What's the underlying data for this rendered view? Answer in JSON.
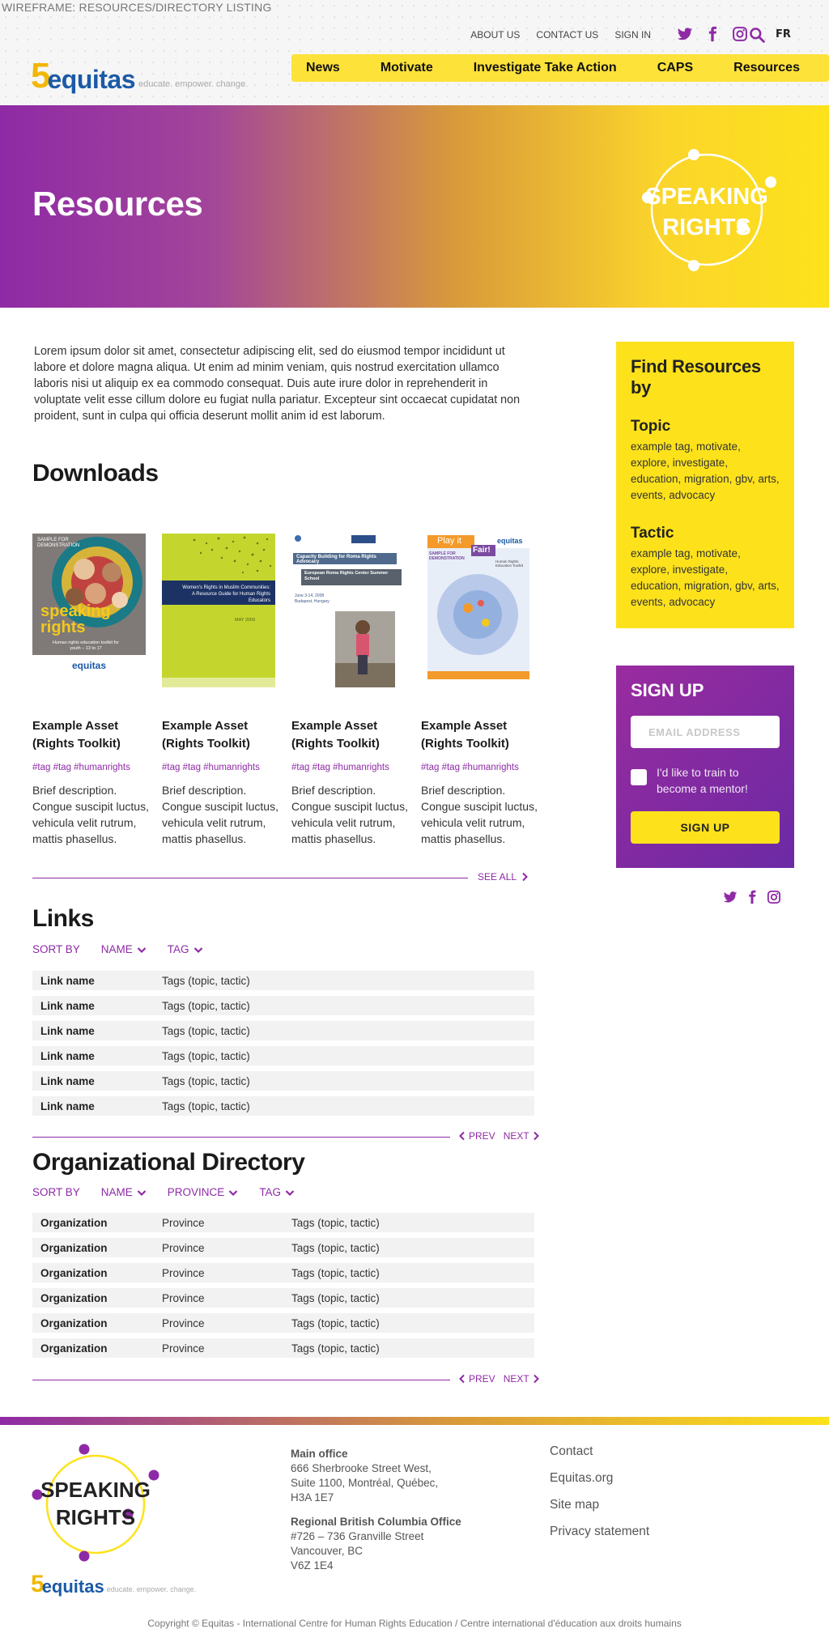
{
  "wireframe_label": "WIREFRAME: RESOURCES/DIRECTORY LISTING",
  "top_links": [
    "ABOUT US",
    "CONTACT US",
    "SIGN IN"
  ],
  "language": "FR",
  "logo": {
    "number": "5",
    "name": "equitas",
    "tagline": "educate. empower. change."
  },
  "main_nav": [
    "News",
    "Motivate",
    "Investigate Take Action",
    "CAPS",
    "Resources"
  ],
  "hero": {
    "title": "Resources",
    "badge_lines": [
      "SPEAKING",
      "RIGHTS"
    ]
  },
  "intro": "Lorem ipsum dolor sit amet, consectetur adipiscing elit, sed do eiusmod tempor incididunt ut labore et dolore magna aliqua. Ut enim ad minim veniam, quis nostrud exercitation ullamco laboris nisi ut aliquip ex ea commodo consequat. Duis aute irure dolor in reprehenderit in voluptate velit esse cillum dolore eu fugiat nulla pariatur. Excepteur sint occaecat cupidatat non proident, sunt in culpa qui officia deserunt mollit anim id est laborum.",
  "downloads": {
    "title": "Downloads",
    "see_all": "SEE ALL",
    "cards": [
      {
        "title": "Example Asset (Rights Toolkit)",
        "tags": "#tag #tag #humanrights",
        "desc": "Brief description. Congue suscipit luctus, vehicula velit rutrum, mattis phasellus.",
        "cover": {
          "top": "SAMPLE FOR DEMONSTRATION",
          "big1": "speaking",
          "big2": "rights",
          "sub": "Human rights education toolkit for youth – 13 to 17",
          "brand": "equitas"
        }
      },
      {
        "title": "Example Asset (Rights Toolkit)",
        "tags": "#tag #tag #humanrights",
        "desc": "Brief description. Congue suscipit luctus, vehicula velit rutrum, mattis phasellus.",
        "cover": {
          "line1": "Women's Rights in Muslim Communities:",
          "line2": "A Resource Guide for Human Rights Educators",
          "date": "MAY 2009"
        }
      },
      {
        "title": "Example Asset (Rights Toolkit)",
        "tags": "#tag #tag #humanrights",
        "desc": "Brief description. Congue suscipit luctus, vehicula velit rutrum, mattis phasellus.",
        "cover": {
          "band1": "Capacity Building for Roma Rights Advocacy",
          "band2": "European Roma Rights Center Summer School",
          "meta": "June 3-14, 2008 Budapest, Hungary"
        }
      },
      {
        "title": "Example Asset (Rights Toolkit)",
        "tags": "#tag #tag #humanrights",
        "desc": "Brief description. Congue suscipit luctus, vehicula velit rutrum, mattis phasellus.",
        "cover": {
          "play": "Play it",
          "fair": "Fair!",
          "brand": "equitas",
          "sample": "SAMPLE FOR DEMONSTRATION",
          "sub": "Human Rights Education Toolkit"
        }
      }
    ]
  },
  "links": {
    "title": "Links",
    "sort_label": "SORT BY",
    "sort_options": [
      "NAME",
      "TAG"
    ],
    "rows": [
      {
        "name": "Link name",
        "tags": "Tags (topic, tactic)"
      },
      {
        "name": "Link name",
        "tags": "Tags (topic, tactic)"
      },
      {
        "name": "Link name",
        "tags": "Tags (topic, tactic)"
      },
      {
        "name": "Link name",
        "tags": "Tags (topic, tactic)"
      },
      {
        "name": "Link name",
        "tags": "Tags (topic, tactic)"
      },
      {
        "name": "Link name",
        "tags": "Tags (topic, tactic)"
      }
    ],
    "prev": "PREV",
    "next": "NEXT"
  },
  "directory": {
    "title": "Organizational Directory",
    "sort_label": "SORT BY",
    "sort_options": [
      "NAME",
      "PROVINCE",
      "TAG"
    ],
    "rows": [
      {
        "org": "Organization",
        "province": "Province",
        "tags": "Tags (topic, tactic)"
      },
      {
        "org": "Organization",
        "province": "Province",
        "tags": "Tags (topic, tactic)"
      },
      {
        "org": "Organization",
        "province": "Province",
        "tags": "Tags (topic, tactic)"
      },
      {
        "org": "Organization",
        "province": "Province",
        "tags": "Tags (topic, tactic)"
      },
      {
        "org": "Organization",
        "province": "Province",
        "tags": "Tags (topic, tactic)"
      },
      {
        "org": "Organization",
        "province": "Province",
        "tags": "Tags (topic, tactic)"
      }
    ],
    "prev": "PREV",
    "next": "NEXT"
  },
  "sidebar": {
    "find_title": "Find Resources by",
    "topic_label": "Topic",
    "topic_tags": "example tag, motivate, explore, investigate, education, migration, gbv, arts, events, advocacy",
    "tactic_label": "Tactic",
    "tactic_tags": "example tag, motivate, explore, investigate, education, migration, gbv, arts, events, advocacy",
    "signup_title": "SIGN UP",
    "email_placeholder": "EMAIL ADDRESS",
    "mentor_label": "I'd like to train to become a mentor!",
    "signup_button": "SIGN UP"
  },
  "footer": {
    "badge_lines": [
      "SPEAKING",
      "RIGHTS"
    ],
    "main_office_label": "Main office",
    "main_office_lines": [
      "666 Sherbrooke Street West,",
      "Suite 1100, Montréal, Québec,",
      "H3A 1E7"
    ],
    "bc_office_label": "Regional British Columbia Office",
    "bc_office_lines": [
      "#726 – 736 Granville Street",
      "Vancouver, BC",
      "V6Z 1E4"
    ],
    "links": [
      "Contact",
      "Equitas.org",
      "Site map",
      "Privacy statement"
    ],
    "copyright": "Copyright © Equitas - International Centre for Human Rights Education / Centre international d'éducation aux droits humains"
  },
  "colors": {
    "purple": "#8e2aa5",
    "yellow": "#fde21b",
    "blue": "#1b5aa6",
    "gold": "#f2b705"
  },
  "icons": [
    "twitter-icon",
    "facebook-icon",
    "instagram-icon",
    "search-icon",
    "chevron-right-icon",
    "chevron-left-icon",
    "chevron-down-icon"
  ]
}
